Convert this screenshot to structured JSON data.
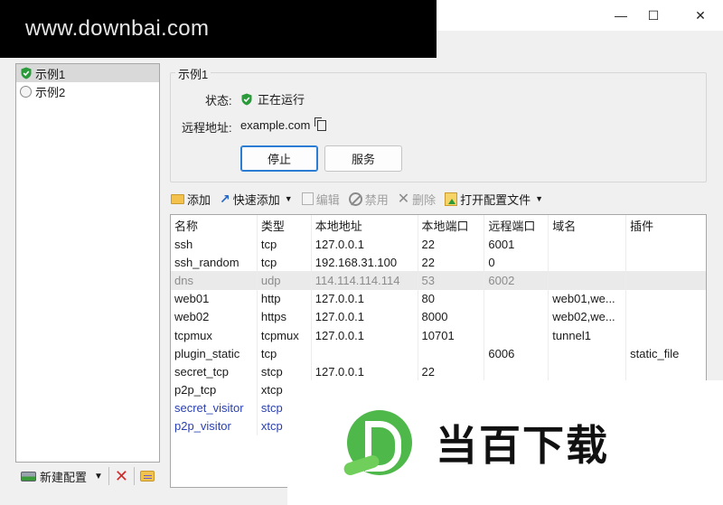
{
  "watermark": "www.downbai.com",
  "window_controls": {
    "minimize": "—",
    "maximize": "☐",
    "close": "✕"
  },
  "tree": [
    {
      "label": "示例1",
      "status": "running",
      "selected": true
    },
    {
      "label": "示例2",
      "status": "stopped",
      "selected": false
    }
  ],
  "bottom": {
    "new_config": "新建配置",
    "caret": "▼"
  },
  "detail": {
    "group_title": "示例1",
    "status_label": "状态:",
    "status_value": "正在运行",
    "remote_label": "远程地址:",
    "remote_value": "example.com",
    "stop_button": "停止",
    "service_button": "服务"
  },
  "toolbar": {
    "add": "添加",
    "quick_add": "快速添加",
    "edit": "编辑",
    "disable": "禁用",
    "delete": "删除",
    "open_config": "打开配置文件"
  },
  "table": {
    "headers": [
      "名称",
      "类型",
      "本地地址",
      "本地端口",
      "远程端口",
      "域名",
      "插件"
    ],
    "rows": [
      [
        "ssh",
        "tcp",
        "127.0.0.1",
        "22",
        "6001",
        "",
        ""
      ],
      [
        "ssh_random",
        "tcp",
        "192.168.31.100",
        "22",
        "0",
        "",
        ""
      ],
      [
        "dns",
        "udp",
        "114.114.114.114",
        "53",
        "6002",
        "",
        ""
      ],
      [
        "web01",
        "http",
        "127.0.0.1",
        "80",
        "",
        "web01,we...",
        ""
      ],
      [
        "web02",
        "https",
        "127.0.0.1",
        "8000",
        "",
        "web02,we...",
        ""
      ],
      [
        "tcpmux",
        "tcpmux",
        "127.0.0.1",
        "10701",
        "",
        "tunnel1",
        ""
      ],
      [
        "plugin_static",
        "tcp",
        "",
        "",
        "6006",
        "",
        "static_file"
      ],
      [
        "secret_tcp",
        "stcp",
        "127.0.0.1",
        "22",
        "",
        "",
        ""
      ],
      [
        "p2p_tcp",
        "xtcp",
        "",
        "",
        "",
        "",
        ""
      ],
      [
        "secret_visitor",
        "stcp",
        "",
        "",
        "",
        "",
        ""
      ],
      [
        "p2p_visitor",
        "xtcp",
        "",
        "",
        "",
        "",
        ""
      ]
    ]
  },
  "brand_text": "当百下载",
  "colors": {
    "running": "#2a9a3a",
    "visitor_text": "#2a3fb0",
    "accent": "#2b7cd3"
  }
}
